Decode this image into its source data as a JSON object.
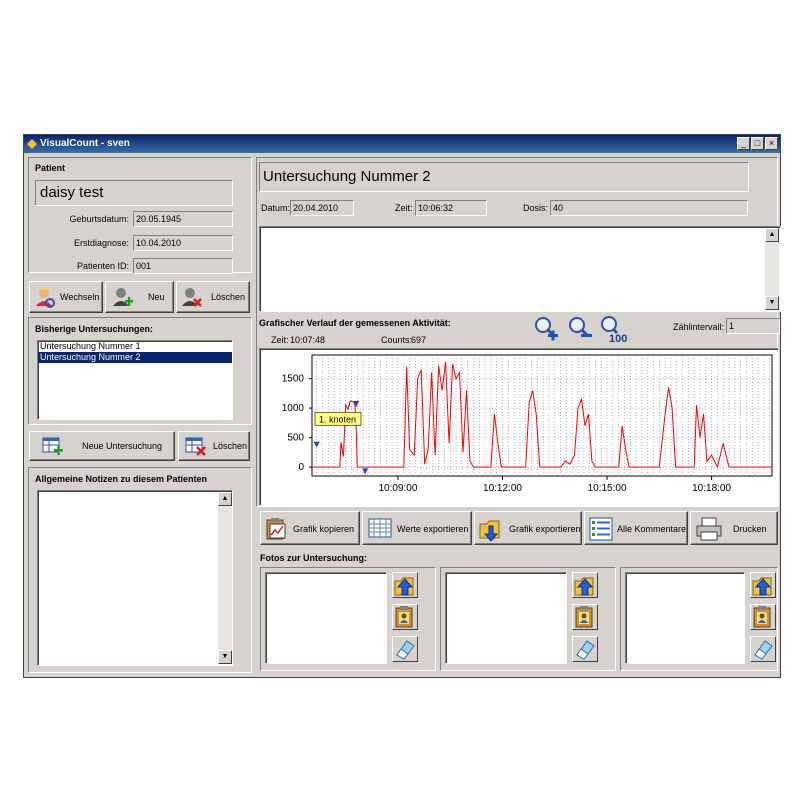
{
  "window": {
    "title": "VisualCount - sven",
    "min": "_",
    "max": "□",
    "close": "×"
  },
  "patient": {
    "heading": "Patient",
    "name": "daisy test",
    "fields": [
      {
        "label": "Geburtsdatum:",
        "value": "20.05.1945"
      },
      {
        "label": "Erstdiagnose:",
        "value": "10.04.2010"
      },
      {
        "label": "Patienten ID:",
        "value": "001"
      }
    ],
    "buttons": {
      "switch": "Wechseln",
      "new": "Neu",
      "delete": "Löschen"
    }
  },
  "exams": {
    "heading": "Bisherige Untersuchungen:",
    "items": [
      "Untersuchung Nummer 1",
      "Untersuchung Nummer 2"
    ],
    "selected_index": 1,
    "new_button": "Neue Untersuchung",
    "delete_button": "Löschen"
  },
  "notes": {
    "heading": "Allgemeine Notizen zu diesem Patienten",
    "value": ""
  },
  "exam_detail": {
    "title": "Untersuchung Nummer 2",
    "date_label": "Datum:",
    "date": "20.04.2010",
    "time_label": "Zeit:",
    "time": "10:06:32",
    "dose_label": "Dosis:",
    "dose": "40",
    "comment": ""
  },
  "chart_panel": {
    "heading": "Grafischer Verlauf der gemessenen Aktivität:",
    "cursor_time_label": "Zeit:",
    "cursor_time": "10:07:48",
    "counts_label": "Counts:",
    "counts": "697",
    "interval_label": "Zählintervall:",
    "interval": "1",
    "zoom_100_label": "100",
    "annotation": "1. knoten"
  },
  "chart_data": {
    "type": "line",
    "series": [
      {
        "color": "#ff0000"
      }
    ],
    "ylim": [
      -150,
      1900
    ],
    "yticks": [
      "0",
      "500",
      "1000",
      "1500"
    ],
    "ytick_values": [
      0,
      500,
      1000,
      1500
    ],
    "xlim": [
      "10:06:32",
      "10:19:44"
    ],
    "xticks": [
      "10:09:00",
      "10:12:00",
      "10:15:00",
      "10:18:00"
    ],
    "grid": true,
    "points": [
      [
        "10:06:32",
        0
      ],
      [
        "10:07:20",
        0
      ],
      [
        "10:07:22",
        420
      ],
      [
        "10:07:26",
        180
      ],
      [
        "10:07:30",
        1050
      ],
      [
        "10:07:34",
        980
      ],
      [
        "10:07:38",
        1120
      ],
      [
        "10:07:44",
        1100
      ],
      [
        "10:07:46",
        1050
      ],
      [
        "10:07:48",
        697
      ],
      [
        "10:07:50",
        0
      ],
      [
        "10:08:30",
        0
      ],
      [
        "10:09:00",
        0
      ],
      [
        "10:09:10",
        0
      ],
      [
        "10:09:15",
        1700
      ],
      [
        "10:09:20",
        300
      ],
      [
        "10:09:28",
        200
      ],
      [
        "10:09:34",
        1500
      ],
      [
        "10:09:40",
        1650
      ],
      [
        "10:09:46",
        50
      ],
      [
        "10:09:52",
        300
      ],
      [
        "10:09:58",
        1600
      ],
      [
        "10:10:04",
        200
      ],
      [
        "10:10:10",
        1720
      ],
      [
        "10:10:16",
        1300
      ],
      [
        "10:10:22",
        1780
      ],
      [
        "10:10:28",
        400
      ],
      [
        "10:10:34",
        1750
      ],
      [
        "10:10:40",
        1500
      ],
      [
        "10:10:46",
        1600
      ],
      [
        "10:10:52",
        250
      ],
      [
        "10:10:58",
        1300
      ],
      [
        "10:11:04",
        100
      ],
      [
        "10:11:10",
        0
      ],
      [
        "10:11:40",
        0
      ],
      [
        "10:11:46",
        900
      ],
      [
        "10:11:52",
        400
      ],
      [
        "10:11:58",
        0
      ],
      [
        "10:12:40",
        0
      ],
      [
        "10:12:46",
        1100
      ],
      [
        "10:12:52",
        1300
      ],
      [
        "10:12:58",
        900
      ],
      [
        "10:13:04",
        0
      ],
      [
        "10:13:40",
        0
      ],
      [
        "10:13:48",
        100
      ],
      [
        "10:13:56",
        50
      ],
      [
        "10:14:04",
        200
      ],
      [
        "10:14:10",
        1000
      ],
      [
        "10:14:16",
        1150
      ],
      [
        "10:14:22",
        700
      ],
      [
        "10:14:28",
        900
      ],
      [
        "10:14:34",
        100
      ],
      [
        "10:14:40",
        0
      ],
      [
        "10:15:20",
        0
      ],
      [
        "10:15:26",
        700
      ],
      [
        "10:15:32",
        300
      ],
      [
        "10:15:38",
        0
      ],
      [
        "10:16:30",
        0
      ],
      [
        "10:16:40",
        900
      ],
      [
        "10:16:46",
        1350
      ],
      [
        "10:16:52",
        1000
      ],
      [
        "10:16:58",
        0
      ],
      [
        "10:17:30",
        0
      ],
      [
        "10:17:34",
        1050
      ],
      [
        "10:17:40",
        500
      ],
      [
        "10:17:46",
        900
      ],
      [
        "10:17:52",
        100
      ],
      [
        "10:18:00",
        200
      ],
      [
        "10:18:10",
        0
      ],
      [
        "10:18:20",
        400
      ],
      [
        "10:18:30",
        0
      ],
      [
        "10:19:44",
        0
      ]
    ]
  },
  "toolbar": {
    "copy": "Grafik kopieren",
    "export_values": "Werte exportieren",
    "export_chart": "Grafik exportieren",
    "comments": "Alle Kommentare",
    "print": "Drucken"
  },
  "photos": {
    "heading": "Fotos zur Untersuchung:"
  },
  "colors": {
    "titlebar": "#0a246a",
    "selection": "#0a246a",
    "series": "#ff0000",
    "face": "#d6d3ce"
  },
  "icons": [
    "user-swap-icon",
    "user-add-icon",
    "user-delete-icon",
    "table-add-icon",
    "table-delete-icon",
    "zoom-in-icon",
    "zoom-out-icon",
    "zoom-100-icon",
    "clipboard-chart-icon",
    "grid-export-icon",
    "folder-export-icon",
    "list-icon",
    "printer-icon",
    "folder-up-icon",
    "clipboard-person-icon",
    "eraser-icon"
  ]
}
